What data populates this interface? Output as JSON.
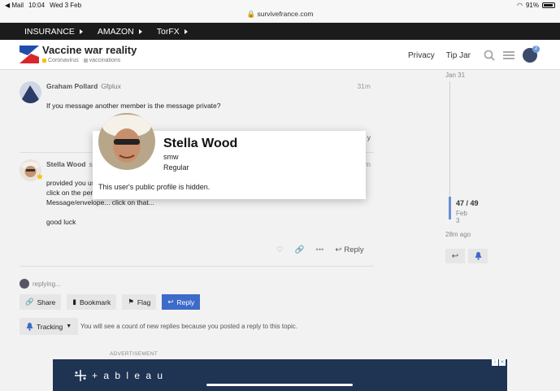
{
  "status_bar": {
    "back_app": "◀ Mail",
    "time": "10:04",
    "date": "Wed 3 Feb",
    "url": "survivefrance.com",
    "battery": "91%"
  },
  "topnav": {
    "items": [
      "INSURANCE",
      "AMAZON",
      "TorFX"
    ]
  },
  "header": {
    "title": "Vaccine war reality",
    "categories": [
      {
        "label": "Coronavirus",
        "color": "#f1c40f"
      },
      {
        "label": "vaccinations",
        "color": "#bbbbbb"
      }
    ],
    "links": [
      "Privacy",
      "Tip Jar"
    ],
    "notification_count": "2"
  },
  "posts": [
    {
      "author": "Graham Pollard",
      "username": "Gfplux",
      "time": "31m",
      "body": [
        "If you message another member is the message private?"
      ],
      "trailing": "y"
    },
    {
      "author": "Stella Wood",
      "username": "s",
      "time": "m",
      "body": [
        "provided you us",
        "click on the pers",
        "Message/envelope... click on that...",
        "",
        "good luck"
      ]
    }
  ],
  "post_actions": {
    "reply_label": "Reply"
  },
  "user_card": {
    "name": "Stella Wood",
    "username": "smw",
    "title": "Regular",
    "note": "This user's public profile is hidden."
  },
  "timeline": {
    "start_date": "Jan 31",
    "position": "47 / 49",
    "position_date": "Feb 3",
    "ago": "28m ago"
  },
  "replying": {
    "label": "replying..."
  },
  "buttons": {
    "share": "Share",
    "bookmark": "Bookmark",
    "flag": "Flag",
    "reply": "Reply"
  },
  "tracking": {
    "label": "Tracking",
    "description": "You will see a count of new replies because you posted a reply to this topic."
  },
  "ad": {
    "label": "ADVERTISEMENT",
    "brand": "+ a b l e a u"
  }
}
